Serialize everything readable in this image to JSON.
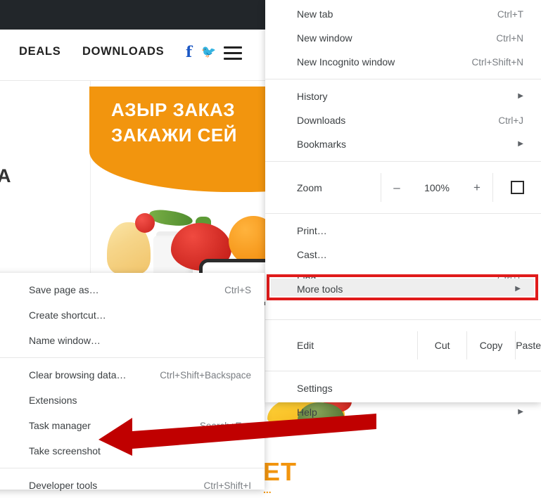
{
  "webpage": {
    "nav": {
      "deals": "DEALS",
      "downloads": "DOWNLOADS",
      "facebook_icon": "facebook-icon",
      "twitter_icon": "twitter-icon",
      "menu_icon": "hamburger-icon"
    },
    "banner": {
      "line1": "АЗЫР ЗАКАЗ",
      "line2": "ЗАКАЖИ СЕЙ"
    },
    "side_letter": "А",
    "footer_logo": "ET",
    "footer_sub": "..."
  },
  "main_menu": {
    "group1": [
      {
        "label": "New tab",
        "accel": "Ctrl+T",
        "caret": ""
      },
      {
        "label": "New window",
        "accel": "Ctrl+N",
        "caret": ""
      },
      {
        "label": "New Incognito window",
        "accel": "Ctrl+Shift+N",
        "caret": ""
      }
    ],
    "group2": [
      {
        "label": "History",
        "accel": "",
        "caret": "▶"
      },
      {
        "label": "Downloads",
        "accel": "Ctrl+J",
        "caret": ""
      },
      {
        "label": "Bookmarks",
        "accel": "",
        "caret": "▶"
      }
    ],
    "zoom_row": {
      "label": "Zoom",
      "minus": "–",
      "level": "100%",
      "plus": "+",
      "fullscreen_icon": "fullscreen-icon"
    },
    "group3": [
      {
        "label": "Print…",
        "accel": "",
        "caret": ""
      },
      {
        "label": "Cast…",
        "accel": "",
        "caret": ""
      },
      {
        "label": "Find…",
        "accel": "Ctrl+F",
        "caret": ""
      }
    ],
    "more_tools": {
      "label": "More tools",
      "caret": "▶",
      "highlight_color": "#e01b1b"
    },
    "edit_row": {
      "label": "Edit",
      "cut": "Cut",
      "copy": "Copy",
      "paste": "Paste"
    },
    "group4": [
      {
        "label": "Settings",
        "accel": "",
        "caret": ""
      },
      {
        "label": "Help",
        "accel": "",
        "caret": "▶"
      }
    ]
  },
  "submenu": {
    "group1": [
      {
        "label": "Save page as…",
        "accel": "Ctrl+S"
      },
      {
        "label": "Create shortcut…",
        "accel": ""
      },
      {
        "label": "Name window…",
        "accel": ""
      }
    ],
    "group2": [
      {
        "label": "Clear browsing data…",
        "accel": "Ctrl+Shift+Backspace"
      },
      {
        "label": "Extensions",
        "accel": ""
      },
      {
        "label": "Task manager",
        "accel": "Search+Esc"
      },
      {
        "label": "Take screenshot",
        "accel": ""
      }
    ],
    "group3": [
      {
        "label": "Developer tools",
        "accel": "Ctrl+Shift+I"
      }
    ]
  },
  "annotation": {
    "arrow_icon": "left-pointing-arrow",
    "arrow_color": "#c00000"
  }
}
